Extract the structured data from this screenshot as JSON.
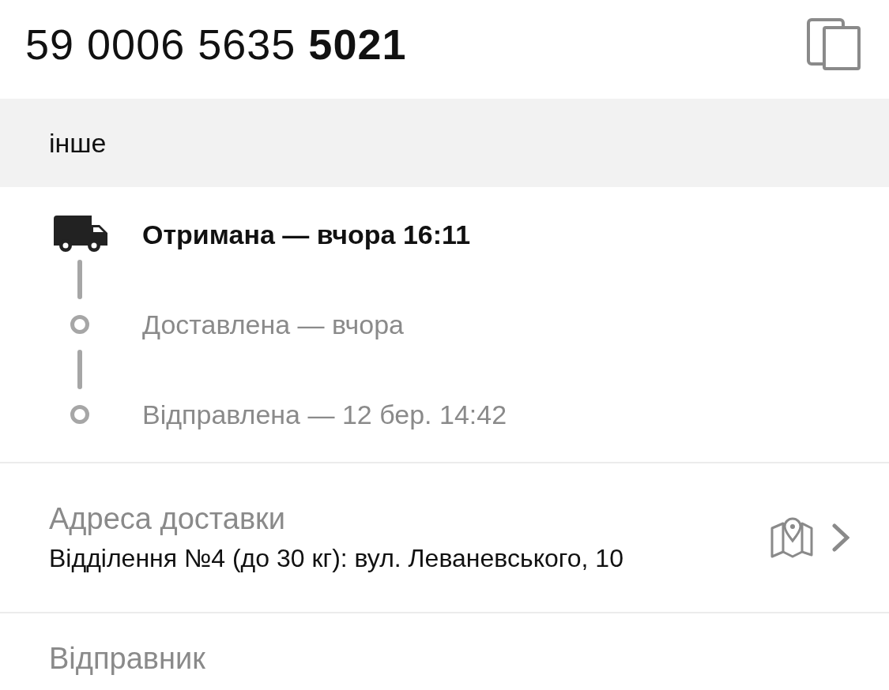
{
  "tracking_number": "59 0006 5635 **5021**",
  "category": "інше",
  "timeline": [
    {
      "kind": "current",
      "text": "Отримана — вчора 16:11"
    },
    {
      "kind": "past",
      "text": "Доставлена — вчора"
    },
    {
      "kind": "past",
      "text": "Відправлена — 12 бер. 14:42"
    }
  ],
  "delivery_address": {
    "label": "Адреса доставки",
    "value": "Відділення №4 (до 30 кг): вул. Леваневського, 10"
  },
  "sender": {
    "label": "Відправник"
  }
}
